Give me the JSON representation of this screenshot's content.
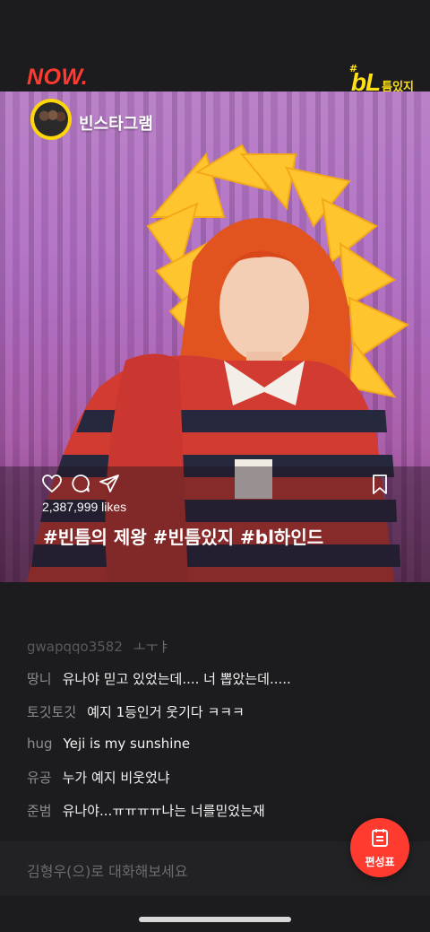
{
  "header": {
    "now_logo": "NOW.",
    "show_logo_big": "bL",
    "show_logo_small": "틈있지",
    "show_logo_hash": "#"
  },
  "post": {
    "account_name": "빈스타그램",
    "likes": "2,387,999 likes",
    "hashtags": "#빈틈의 제왕 #빈틈있지 #bl하인드"
  },
  "chat": {
    "messages": [
      {
        "user": "gwapqqo3582",
        "text": "ㅗㅜㅑ"
      },
      {
        "user": "땅니",
        "text": "유나야 믿고 있었는데.... 너 뽑았는데....."
      },
      {
        "user": "토깃토깃",
        "text": "예지 1등인거 웃기다 ㅋㅋㅋ"
      },
      {
        "user": "hug",
        "text": "Yeji is my sunshine"
      },
      {
        "user": "유공",
        "text": "누가 예지 비웃었냐"
      },
      {
        "user": "준범",
        "text": "유나야...ㅠㅠㅠㅠ나는 너를믿었는재"
      }
    ]
  },
  "input": {
    "placeholder": "김형우(으)로 대화해보세요"
  },
  "schedule_button": {
    "label": "편성표"
  },
  "colors": {
    "accent": "#ff3b30",
    "logo_yellow": "#ffe014",
    "background": "#1c1c1e"
  }
}
